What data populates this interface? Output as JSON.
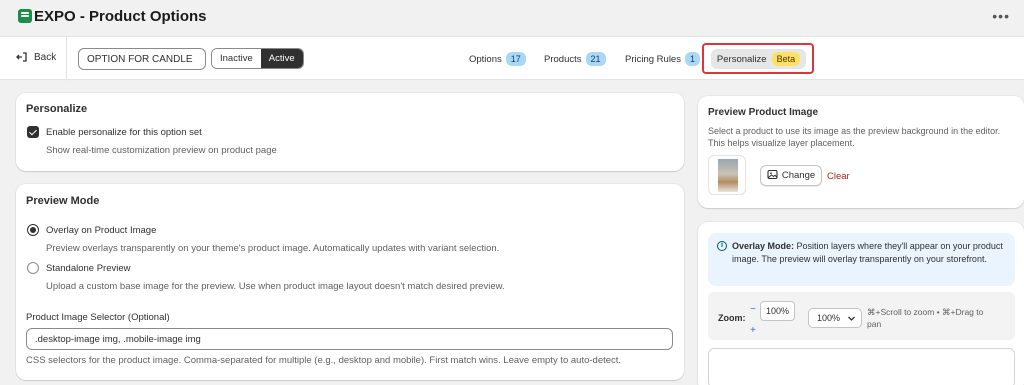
{
  "app": {
    "title": "EXPO - Product Options",
    "more_icon": "•••"
  },
  "toolbar": {
    "back_label": "Back",
    "option_name": "OPTION FOR CANDLE",
    "status_options": [
      "Inactive",
      "Active"
    ],
    "status_selected": "Active",
    "tabs": [
      {
        "label": "Options",
        "count": "17"
      },
      {
        "label": "Products",
        "count": "21"
      },
      {
        "label": "Pricing Rules",
        "count": "1"
      },
      {
        "label": "Personalize",
        "badge": "Beta",
        "selected": true
      }
    ]
  },
  "personalize_card": {
    "title": "Personalize",
    "checkbox_label": "Enable personalize for this option set",
    "checkbox_checked": true,
    "help": "Show real-time customization preview on product page"
  },
  "preview_mode_card": {
    "title": "Preview Mode",
    "options": [
      {
        "label": "Overlay on Product Image",
        "help": "Preview overlays transparently on your theme's product image. Automatically updates with variant selection.",
        "checked": true
      },
      {
        "label": "Standalone Preview",
        "help": "Upload a custom base image for the preview. Use when product image layout doesn't match desired preview.",
        "checked": false
      }
    ],
    "selector_label": "Product Image Selector (Optional)",
    "selector_value": ".desktop-image img, .mobile-image img",
    "selector_help": "CSS selectors for the product image. Comma-separated for multiple (e.g., desktop and mobile). First match wins. Leave empty to auto-detect."
  },
  "preview_image_card": {
    "title": "Preview Product Image",
    "description_line1": "Select a product to use its image as the preview background in the editor.",
    "description_line2": "This helps visualize layer placement.",
    "change_label": "Change",
    "clear_label": "Clear"
  },
  "editor_card": {
    "info_bold": "Overlay Mode:",
    "info_text": " Position layers where they'll appear on your product image. The preview will overlay transparently on your storefront.",
    "zoom_label": "Zoom:",
    "zoom_minus": "−",
    "zoom_plus": "+",
    "zoom_value": "100%",
    "zoom_select_value": "100%",
    "zoom_hint_line1": "⌘+Scroll to zoom • ⌘+Drag to",
    "zoom_hint_line2": "pan"
  },
  "colors": {
    "accent_dark": "#303030",
    "badge_blue": "#a8d8f8",
    "beta_yellow": "#ffe066",
    "highlight_red": "#e0343c",
    "clear_red": "#b3261e"
  }
}
